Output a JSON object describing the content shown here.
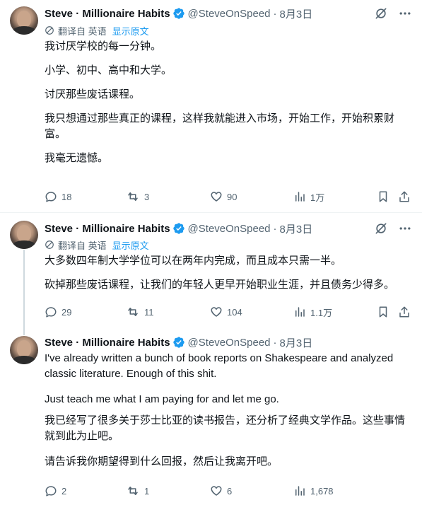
{
  "colors": {
    "text": "#0f1419",
    "secondary": "#536471",
    "accent": "#1d9bf0",
    "border": "#eff3f4",
    "thread_line": "#cfd9de"
  },
  "tweets": [
    {
      "name": "Steve · Millionaire Habits",
      "handle": "@SteveOnSpeed",
      "dot": "·",
      "date": "8月3日",
      "translated_label": "翻译自 英语",
      "show_original": "显示原文",
      "paragraphs": [
        "我讨厌学校的每一分钟。",
        "小学、初中、高中和大学。",
        "讨厌那些废话课程。",
        "我只想通过那些真正的课程，这样我就能进入市场，开始工作，开始积累财富。",
        "我毫无遗憾。"
      ],
      "replies": "18",
      "reposts": "3",
      "likes": "90",
      "views": "1万"
    },
    {
      "name": "Steve · Millionaire Habits",
      "handle": "@SteveOnSpeed",
      "dot": "·",
      "date": "8月3日",
      "translated_label": "翻译自 英语",
      "show_original": "显示原文",
      "paragraphs": [
        "大多数四年制大学学位可以在两年内完成，而且成本只需一半。",
        "砍掉那些废话课程，让我们的年轻人更早开始职业生涯，并且债务少得多。"
      ],
      "replies": "29",
      "reposts": "11",
      "likes": "104",
      "views": "1.1万"
    },
    {
      "name": "Steve · Millionaire Habits",
      "handle": "@SteveOnSpeed",
      "dot": "·",
      "date": "8月3日",
      "paragraphs": [
        "I've already written a bunch of book reports on Shakespeare and analyzed classic literature. Enough of this shit.",
        "Just teach me what I am paying for and let me go.",
        "我已经写了很多关于莎士比亚的读书报告，还分析了经典文学作品。这些事情就到此为止吧。",
        "请告诉我你期望得到什么回报，然后让我离开吧。"
      ],
      "replies": "2",
      "reposts": "1",
      "likes": "6",
      "views": "1,678"
    }
  ]
}
